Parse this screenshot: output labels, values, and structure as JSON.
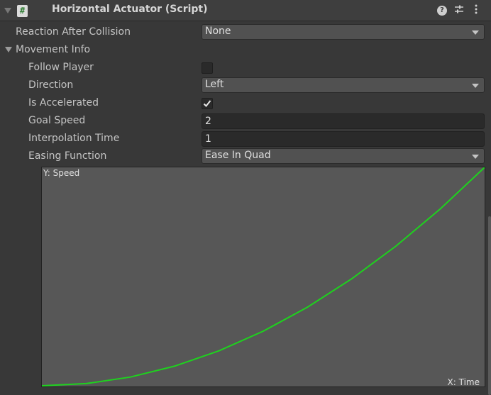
{
  "component": {
    "title": "Horizontal Actuator (Script)",
    "icon_glyph": "#",
    "icons": [
      "help-icon",
      "presets-icon",
      "kebab-menu-icon"
    ]
  },
  "fields": {
    "reaction_after_collision": {
      "label": "Reaction After Collision",
      "value": "None"
    },
    "movement_info": {
      "label": "Movement Info",
      "expanded": true
    },
    "follow_player": {
      "label": "Follow Player",
      "checked": false
    },
    "direction": {
      "label": "Direction",
      "value": "Left"
    },
    "is_accelerated": {
      "label": "Is Accelerated",
      "checked": true
    },
    "goal_speed": {
      "label": "Goal Speed",
      "value": "2"
    },
    "interpolation_time": {
      "label": "Interpolation Time",
      "value": "1"
    },
    "easing_function": {
      "label": "Easing Function",
      "value": "Ease In Quad"
    }
  },
  "chart_data": {
    "type": "line",
    "ylabel": "Y: Speed",
    "xlabel": "X: Time",
    "xlim": [
      0,
      1
    ],
    "ylim": [
      0,
      1
    ],
    "grid": false,
    "series": [
      {
        "color": "#1ed21e",
        "x": [
          0,
          0.1,
          0.2,
          0.3,
          0.4,
          0.5,
          0.6,
          0.7,
          0.8,
          0.9,
          1.0
        ],
        "y": [
          0,
          0.01,
          0.04,
          0.09,
          0.16,
          0.25,
          0.36,
          0.49,
          0.64,
          0.81,
          1.0
        ]
      }
    ],
    "background": "#575757"
  }
}
